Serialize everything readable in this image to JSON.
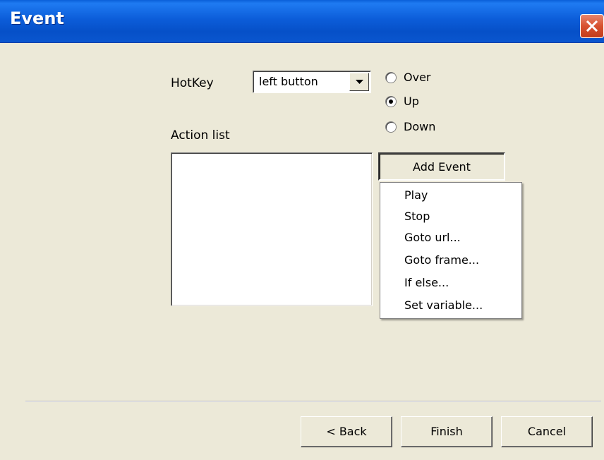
{
  "window": {
    "title": "Event"
  },
  "hotkey": {
    "label": "HotKey",
    "selected": "left button"
  },
  "state_radios": [
    {
      "label": "Over",
      "checked": false
    },
    {
      "label": "Up",
      "checked": true
    },
    {
      "label": "Down",
      "checked": false
    }
  ],
  "action_list": {
    "label": "Action list",
    "items": []
  },
  "add_event": {
    "label": "Add Event",
    "menu": [
      "Play",
      "Stop",
      "Goto url...",
      "Goto frame...",
      "If else...",
      "Set variable..."
    ]
  },
  "footer": {
    "back_label": "< Back",
    "finish_label": "Finish",
    "cancel_label": "Cancel"
  },
  "colors": {
    "titlebar": "#0a56cf",
    "dialog_bg": "#ece9d8",
    "close_button": "#d8512f"
  },
  "icons": {
    "close": "close-icon",
    "dropdown": "chevron-down-icon"
  }
}
